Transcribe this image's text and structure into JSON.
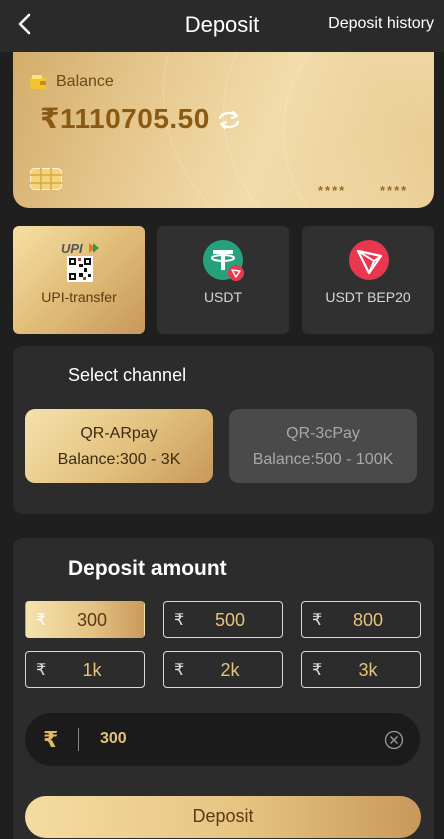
{
  "header": {
    "title": "Deposit",
    "history_label": "Deposit history"
  },
  "balance_card": {
    "label": "Balance",
    "amount": "₹1110705.50",
    "masked_left": "****",
    "masked_right": "****"
  },
  "methods": [
    {
      "label": "UPI-transfer",
      "icon": "upi-qr-icon",
      "active": true
    },
    {
      "label": "USDT",
      "icon": "tether-icon",
      "active": false
    },
    {
      "label": "USDT BEP20",
      "icon": "tron-icon",
      "active": false
    }
  ],
  "upi_logo_text": "UPI",
  "channel_section": {
    "title": "Select channel",
    "channels": [
      {
        "name": "QR-ARpay",
        "range": "Balance:300 - 3K",
        "active": true
      },
      {
        "name": "QR-3cPay",
        "range": "Balance:500 - 100K",
        "active": false
      }
    ]
  },
  "amount_section": {
    "title": "Deposit amount",
    "currency_symbol": "₹",
    "presets": [
      "300",
      "500",
      "800",
      "1k",
      "2k",
      "3k"
    ],
    "selected_preset": "300",
    "input_value": "300"
  },
  "deposit_button_label": "Deposit",
  "colors": {
    "background": "#1f1f1f",
    "panel": "#2c2c2c",
    "gold_light": "#f6e2ad",
    "gold_dark": "#c8985a",
    "gold_text": "#e7c27a"
  }
}
